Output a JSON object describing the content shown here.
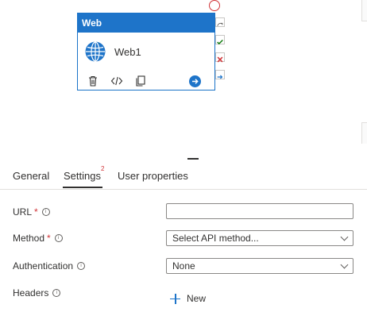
{
  "activity": {
    "type_label": "Web",
    "name": "Web1",
    "icons": [
      "globe-icon",
      "delete-icon",
      "code-icon",
      "clone-icon",
      "arrow-right-circle-icon"
    ],
    "side_actions": [
      "skip-icon",
      "success-check-icon",
      "failure-x-icon",
      "completion-arrow-icon"
    ]
  },
  "tabs": [
    {
      "label": "General"
    },
    {
      "label": "Settings",
      "badge": "2"
    },
    {
      "label": "User properties"
    }
  ],
  "active_tab": "Settings",
  "form": {
    "url": {
      "label": "URL",
      "required": "*",
      "value": ""
    },
    "method": {
      "label": "Method",
      "required": "*",
      "value": "Select API method..."
    },
    "authentication": {
      "label": "Authentication",
      "value": "None"
    },
    "headers": {
      "label": "Headers",
      "new_label": "New"
    }
  },
  "colors": {
    "accent": "#1e74c9",
    "required": "#d13438",
    "success": "#107c10",
    "failure": "#d13438"
  }
}
